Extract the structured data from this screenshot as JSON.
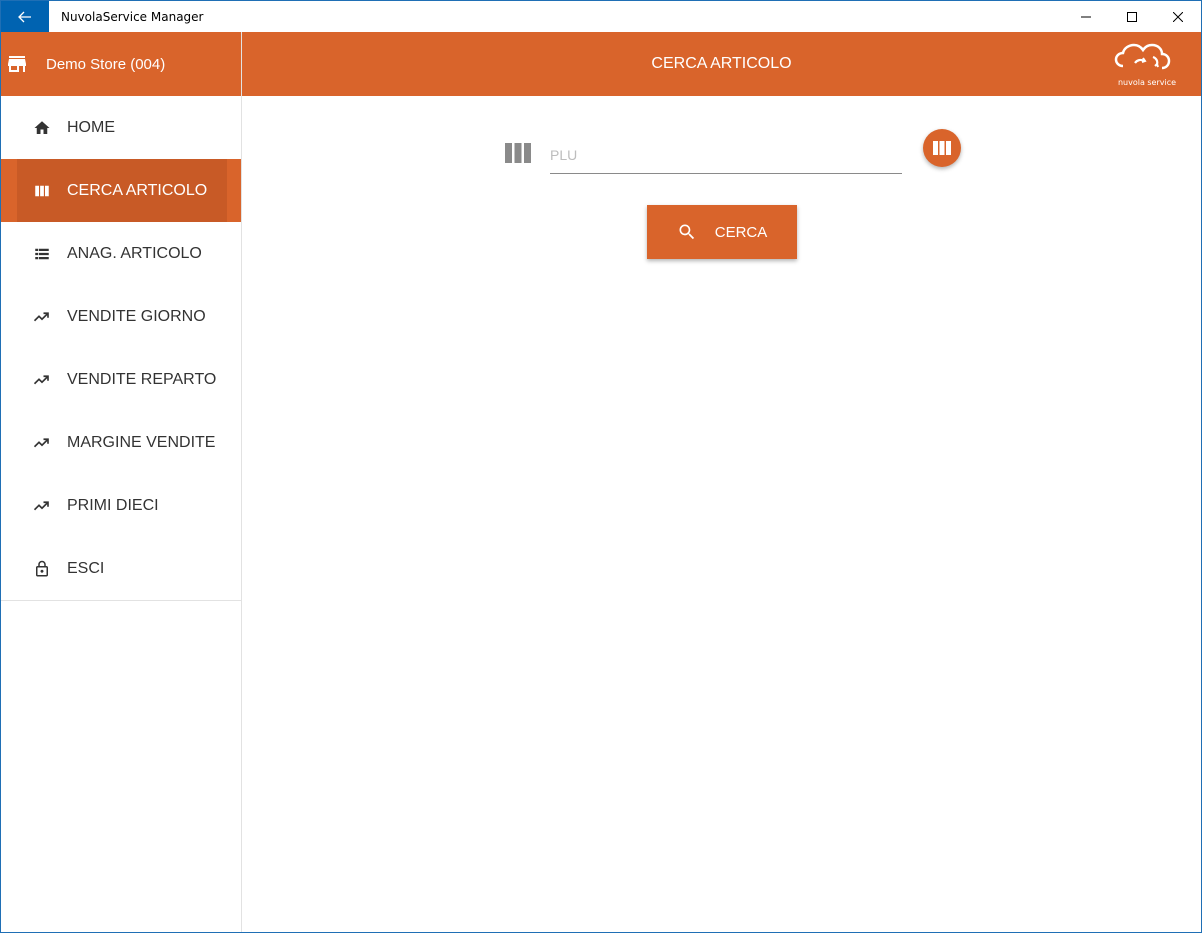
{
  "window": {
    "title": "NuvolaService Manager"
  },
  "sidebar": {
    "store_name": "Demo Store (004)",
    "items": [
      {
        "label": "HOME",
        "icon": "home-icon"
      },
      {
        "label": "CERCA ARTICOLO",
        "icon": "barcode-icon"
      },
      {
        "label": "ANAG. ARTICOLO",
        "icon": "list-icon"
      },
      {
        "label": "VENDITE GIORNO",
        "icon": "trending-up-icon"
      },
      {
        "label": "VENDITE REPARTO",
        "icon": "trending-up-icon"
      },
      {
        "label": "MARGINE VENDITE",
        "icon": "trending-up-icon"
      },
      {
        "label": "PRIMI DIECI",
        "icon": "trending-up-icon"
      },
      {
        "label": "ESCI",
        "icon": "lock-icon"
      }
    ],
    "active_index": 1
  },
  "header": {
    "title": "CERCA ARTICOLO",
    "logo_text": "nuvola service"
  },
  "main": {
    "plu_placeholder": "PLU",
    "plu_value": "",
    "search_label": "CERCA"
  },
  "colors": {
    "accent": "#d9642b",
    "accent_dark": "#c85a26",
    "titlebar_back": "#0063b1"
  }
}
